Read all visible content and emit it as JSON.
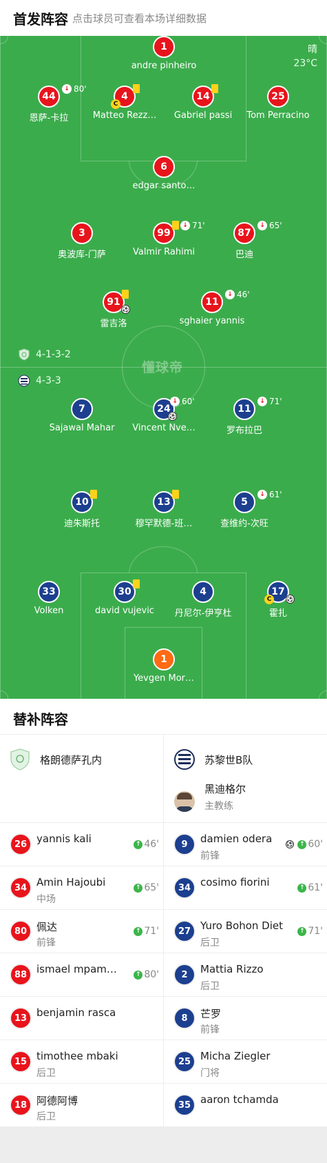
{
  "header": {
    "title": "首发阵容",
    "hint": "点击球员可查看本场详细数据"
  },
  "weather": {
    "condition": "晴",
    "temperature": "23°C"
  },
  "watermark": "懂球帝",
  "formations": {
    "home": "4-1-3-2",
    "away": "4-3-3"
  },
  "colors": {
    "home_kit": "#e8141c",
    "away_kit": "#1c3f8f",
    "away_goalkeeper_kit": "#ff6a13",
    "pitch": "#3bac4c"
  },
  "home_players": [
    {
      "number": "1",
      "name": "andre pinheiro"
    },
    {
      "number": "44",
      "name": "恩萨-卡拉",
      "sub_minute": "80'"
    },
    {
      "number": "4",
      "name": "Matteo Rezz…",
      "captain": "C"
    },
    {
      "number": "14",
      "name": "Gabriel passi"
    },
    {
      "number": "25",
      "name": "Tom Perracino"
    },
    {
      "number": "6",
      "name": "edgar santo…"
    },
    {
      "number": "3",
      "name": "奥波库-门萨"
    },
    {
      "number": "99",
      "name": "Valmir Rahimi",
      "sub_minute": "71'"
    },
    {
      "number": "87",
      "name": "巴迪",
      "sub_minute": "65'"
    },
    {
      "number": "91",
      "name": "雷吉洛"
    },
    {
      "number": "11",
      "name": "sghaier yannis",
      "sub_minute": "46'"
    }
  ],
  "away_players": [
    {
      "number": "7",
      "name": "Sajawal Mahar"
    },
    {
      "number": "24",
      "name": "Vincent Nve…",
      "sub_minute": "60'"
    },
    {
      "number": "11",
      "name": "罗布拉巴",
      "sub_minute": "71'"
    },
    {
      "number": "10",
      "name": "迪朱斯托"
    },
    {
      "number": "13",
      "name": "穆罕默德-班…"
    },
    {
      "number": "5",
      "name": "查维约-次旺",
      "sub_minute": "61'"
    },
    {
      "number": "33",
      "name": "Volken"
    },
    {
      "number": "30",
      "name": "david vujevic"
    },
    {
      "number": "4",
      "name": "丹尼尔-伊亨杜"
    },
    {
      "number": "17",
      "name": "霍扎",
      "captain": "C"
    },
    {
      "number": "1",
      "name": "Yevgen Mor…"
    }
  ],
  "subs_header": {
    "title": "替补阵容"
  },
  "teams": {
    "home": {
      "name": "格朗德萨孔内",
      "logo": "shield-logo"
    },
    "away": {
      "name": "苏黎世B队",
      "logo": "fcz-logo"
    }
  },
  "coach": {
    "name": "黑迪格尔",
    "role": "主教练"
  },
  "home_subs": [
    {
      "number": "26",
      "name": "yannis kali",
      "position": "",
      "in_minute": "46'"
    },
    {
      "number": "34",
      "name": "Amin Hajoubi",
      "position": "中场",
      "in_minute": "65'"
    },
    {
      "number": "80",
      "name": "佩达",
      "position": "前锋",
      "in_minute": "71'"
    },
    {
      "number": "88",
      "name": "ismael mpam…",
      "position": "",
      "in_minute": "80'"
    },
    {
      "number": "13",
      "name": "benjamin rasca",
      "position": "",
      "in_minute": ""
    },
    {
      "number": "15",
      "name": "timothee mbaki",
      "position": "后卫",
      "in_minute": ""
    },
    {
      "number": "18",
      "name": "阿德阿博",
      "position": "后卫",
      "in_minute": ""
    }
  ],
  "away_subs": [
    {
      "number": "9",
      "name": "damien odera",
      "position": "前锋",
      "in_minute": "60'"
    },
    {
      "number": "34",
      "name": "cosimo fiorini",
      "position": "",
      "in_minute": "61'"
    },
    {
      "number": "27",
      "name": "Yuro Bohon Diet",
      "position": "后卫",
      "in_minute": "71'"
    },
    {
      "number": "2",
      "name": "Mattia Rizzo",
      "position": "后卫",
      "in_minute": ""
    },
    {
      "number": "8",
      "name": "芒罗",
      "position": "前锋",
      "in_minute": ""
    },
    {
      "number": "25",
      "name": "Micha Ziegler",
      "position": "门将",
      "in_minute": ""
    },
    {
      "number": "35",
      "name": "aaron tchamda",
      "position": "",
      "in_minute": ""
    }
  ]
}
